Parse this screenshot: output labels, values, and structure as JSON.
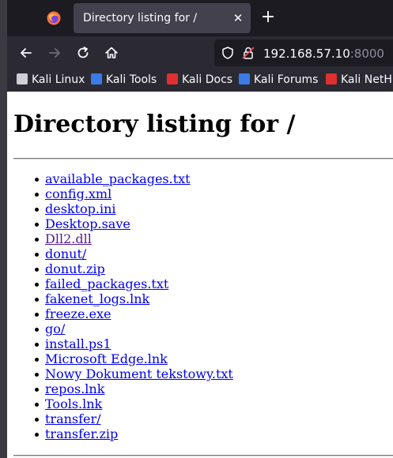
{
  "browser": {
    "tab": {
      "title": "Directory listing for /",
      "close_glyph": "✕"
    },
    "new_tab_glyph": "+",
    "url": {
      "host": "192.168.57.10",
      "port": ":8000"
    },
    "bookmarks": [
      {
        "label": "Kali Linux",
        "icon": "kali-dragon-icon",
        "color": "#cfcfd6"
      },
      {
        "label": "Kali Tools",
        "icon": "kali-tools-icon",
        "color": "#3b7be6"
      },
      {
        "label": "Kali Docs",
        "icon": "kali-docs-icon",
        "color": "#e03030"
      },
      {
        "label": "Kali Forums",
        "icon": "kali-forums-icon",
        "color": "#3b7be6"
      },
      {
        "label": "Kali NetHunter",
        "icon": "kali-nethunter-icon",
        "color": "#e03030"
      }
    ]
  },
  "page": {
    "heading": "Directory listing for /",
    "link_color": "#0000ee",
    "visited_color": "#551a8b",
    "entries": [
      {
        "name": "available_packages.txt",
        "visited": false
      },
      {
        "name": "config.xml",
        "visited": false
      },
      {
        "name": "desktop.ini",
        "visited": false
      },
      {
        "name": "Desktop.save",
        "visited": false
      },
      {
        "name": "Dll2.dll",
        "visited": true
      },
      {
        "name": "donut/",
        "visited": false
      },
      {
        "name": "donut.zip",
        "visited": false
      },
      {
        "name": "failed_packages.txt",
        "visited": false
      },
      {
        "name": "fakenet_logs.lnk",
        "visited": false
      },
      {
        "name": "freeze.exe",
        "visited": false
      },
      {
        "name": "go/",
        "visited": false
      },
      {
        "name": "install.ps1",
        "visited": false
      },
      {
        "name": "Microsoft Edge.lnk",
        "visited": false
      },
      {
        "name": "Nowy Dokument tekstowy.txt",
        "visited": false
      },
      {
        "name": "repos.lnk",
        "visited": false
      },
      {
        "name": "Tools.lnk",
        "visited": false
      },
      {
        "name": "transfer/",
        "visited": false
      },
      {
        "name": "transfer.zip",
        "visited": false
      }
    ]
  }
}
